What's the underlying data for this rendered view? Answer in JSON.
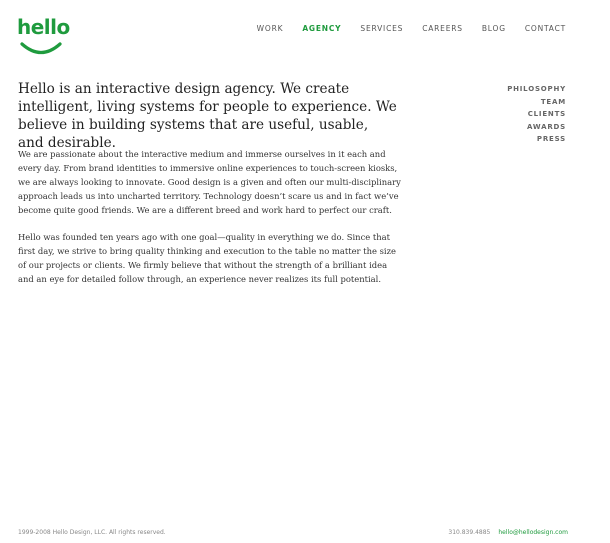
{
  "brand": {
    "logo_text": "hello",
    "accent_color": "#1f9b3e"
  },
  "topnav": {
    "items": [
      {
        "label": "WORK",
        "active": false
      },
      {
        "label": "AGENCY",
        "active": true
      },
      {
        "label": "SERVICES",
        "active": false
      },
      {
        "label": "CAREERS",
        "active": false
      },
      {
        "label": "BLOG",
        "active": false
      },
      {
        "label": "CONTACT",
        "active": false
      }
    ]
  },
  "subnav": {
    "items": [
      {
        "label": "PHILOSOPHY"
      },
      {
        "label": "TEAM"
      },
      {
        "label": "CLIENTS"
      },
      {
        "label": "AWARDS"
      },
      {
        "label": "PRESS"
      }
    ]
  },
  "main": {
    "intro": "Hello is an interactive design agency. We create intelligent, living systems for people to experience. We believe in building systems that are useful, usable, and desirable.",
    "paragraphs": [
      "We are passionate about the interactive medium and immerse ourselves in it each and every day. From brand identities to immersive online experiences to touch-screen kiosks, we are always looking to innovate. Good design is a given and often our multi-disciplinary approach leads us into uncharted territory. Technology doesn’t scare us and in fact we’ve become quite good friends. We are a different breed and work hard to perfect our craft.",
      "Hello was founded ten years ago with one goal—quality in everything we do. Since that first day, we strive to bring quality thinking and execution to the table no matter the size of our projects or clients. We firmly believe that without the strength of a brilliant idea and an eye for detailed follow through, an experience never realizes its full potential."
    ]
  },
  "footer": {
    "copyright": "1999-2008 Hello Design, LLC. All rights reserved.",
    "phone": "310.839.4885",
    "email": "hello@hellodesign.com"
  }
}
